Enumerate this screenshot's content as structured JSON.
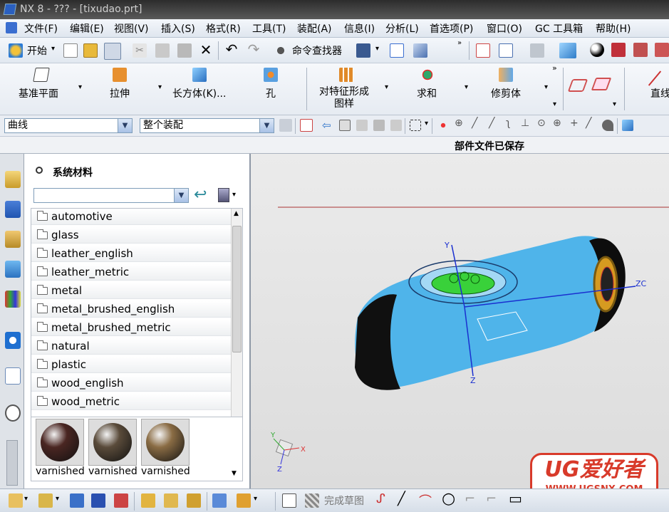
{
  "window": {
    "title": "NX 8 - ??? - [tixudao.prt]"
  },
  "menu": [
    "文件(F)",
    "编辑(E)",
    "视图(V)",
    "插入(S)",
    "格式(R)",
    "工具(T)",
    "装配(A)",
    "信息(I)",
    "分析(L)",
    "首选项(P)",
    "窗口(O)",
    "GC 工具箱",
    "帮助(H)"
  ],
  "toolbar1": {
    "start_label": "开始",
    "command_finder_label": "命令查找器"
  },
  "toolbar2": {
    "items": [
      {
        "label": "基准平面",
        "icon": "datum-plane-icon"
      },
      {
        "label": "拉伸",
        "icon": "extrude-icon"
      },
      {
        "label": "长方体(K)...",
        "icon": "block-icon"
      },
      {
        "label": "孔",
        "icon": "hole-icon"
      },
      {
        "label": "对特征形成\n图样",
        "icon": "pattern-feature-icon"
      },
      {
        "label": "求和",
        "icon": "unite-icon"
      },
      {
        "label": "修剪体",
        "icon": "trim-body-icon"
      },
      {
        "label": "直线",
        "icon": "line-icon"
      }
    ]
  },
  "selection": {
    "filter_value": "曲线",
    "scope_value": "整个装配"
  },
  "status": {
    "message": "部件文件已保存"
  },
  "materials_panel": {
    "title": "系统材料",
    "search_value": "",
    "folders": [
      "automotive",
      "glass",
      "leather_english",
      "leather_metric",
      "metal",
      "metal_brushed_english",
      "metal_brushed_metric",
      "natural",
      "plastic",
      "wood_english",
      "wood_metric"
    ],
    "thumbnails": [
      {
        "label": "varnished",
        "color": "#4a2622"
      },
      {
        "label": "varnished",
        "color": "#5a4b3a"
      },
      {
        "label": "varnished",
        "color": "#8a6c44"
      }
    ]
  },
  "viewport": {
    "axes": {
      "y": "Y",
      "z": "Z",
      "zc": "ZC",
      "small_x": "X",
      "small_y": "Y",
      "small_z": "Z"
    },
    "model_color": "#4fb4ea",
    "highlight_color": "#39d13a"
  },
  "bottombar": {
    "finish_sketch_label": "完成草图"
  },
  "watermark": {
    "brand": "UG爱好者",
    "url": "WWW.UGSNX.COM"
  }
}
